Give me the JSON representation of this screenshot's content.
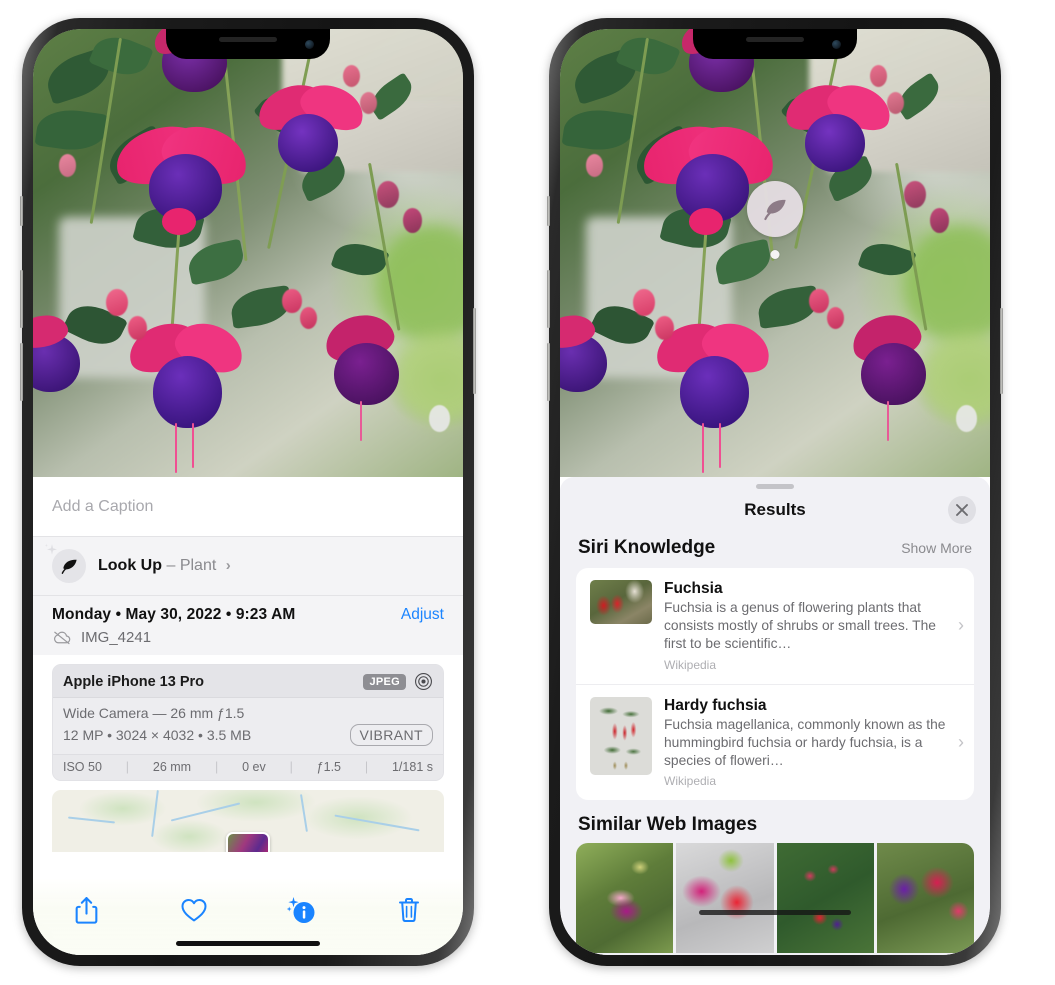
{
  "page": {
    "title": "iPhone Photos app — Visual Look Up (two screens)"
  },
  "left_phone": {
    "name": "photo-detail-screen",
    "caption": {
      "placeholder": "Add a Caption",
      "value": ""
    },
    "lookup": {
      "icon": "leaf-icon",
      "sparkle_icon": "sparkle-icon",
      "label": "Look Up",
      "dash": "–",
      "subject": "Plant",
      "chevron": "›"
    },
    "meta": {
      "date": "Monday • May 30, 2022 • 9:23 AM",
      "adjust_label": "Adjust",
      "cloud_icon": "cloud-slash-icon",
      "filename": "IMG_4241"
    },
    "camera_card": {
      "device": "Apple iPhone 13 Pro",
      "format_badge": "JPEG",
      "aperture_icon": "aperture-icon",
      "lens_line": "Wide Camera — 26 mm ƒ1.5",
      "size_line": "12 MP • 3024 × 4032 • 3.5 MB",
      "style_badge": "VIBRANT",
      "exif": [
        "ISO 50",
        "26 mm",
        "0 ev",
        "ƒ1.5",
        "1/181 s"
      ]
    },
    "map": {
      "pin_label": "photo-location-thumbnail"
    },
    "toolbar": [
      {
        "name": "share-button",
        "icon": "share-icon"
      },
      {
        "name": "favorite-button",
        "icon": "heart-icon"
      },
      {
        "name": "info-button",
        "icon": "info-sparkle-icon"
      },
      {
        "name": "delete-button",
        "icon": "trash-icon"
      }
    ],
    "accent_color": "#1A84FF"
  },
  "right_phone": {
    "name": "visual-lookup-results-screen",
    "badge": {
      "icon": "leaf-icon",
      "name": "visual-lookup-badge"
    },
    "sheet": {
      "grabber": "drag-handle",
      "title": "Results",
      "close_icon": "close-icon"
    },
    "siri_knowledge": {
      "heading": "Siri Knowledge",
      "show_more": "Show More",
      "items": [
        {
          "title": "Fuchsia",
          "description": "Fuchsia is a genus of flowering plants that consists mostly of shrubs or small trees. The first to be scientific…",
          "source": "Wikipedia",
          "thumb": "fuchsia-red-flowers-thumbnail",
          "chevron": "›"
        },
        {
          "title": "Hardy fuchsia",
          "description": "Fuchsia magellanica, commonly known as the hummingbird fuchsia or hardy fuchsia, is a species of floweri…",
          "source": "Wikipedia",
          "thumb": "hardy-fuchsia-specimen-thumbnail",
          "chevron": "›"
        }
      ]
    },
    "similar_web_images": {
      "heading": "Similar Web Images",
      "thumbnails": [
        "fuchsia-pink-white-bloom",
        "fuchsia-red-closeup",
        "fuchsia-bush-buds",
        "fuchsia-purple-magenta-bloom"
      ]
    }
  },
  "colors": {
    "accent_blue": "#1A84FF",
    "sheet_background": "#F1F1F5",
    "card_background": "#FFFFFF",
    "secondary_text": "#6C6C70",
    "tertiary_text": "#AEAEB2"
  }
}
